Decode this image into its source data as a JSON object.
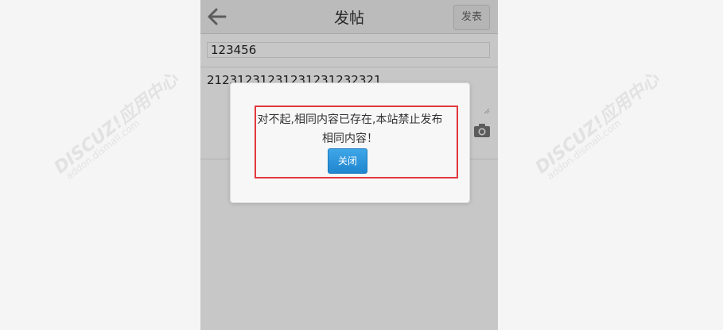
{
  "header": {
    "title": "发帖",
    "post_label": "发表"
  },
  "form": {
    "subject_value": "123456",
    "message_value": "21231231231231231232321"
  },
  "dialog": {
    "line1": "对不起,相同内容已存在,本站禁止发布",
    "line2": "相同内容！",
    "close_label": "关闭"
  },
  "watermark": {
    "brand": "DISCUZ!应用中心",
    "site": "addon.dismall.com",
    "tag": "贰道"
  },
  "colors": {
    "accent_blue": "#2a94db",
    "highlight_red": "#e0393e"
  }
}
